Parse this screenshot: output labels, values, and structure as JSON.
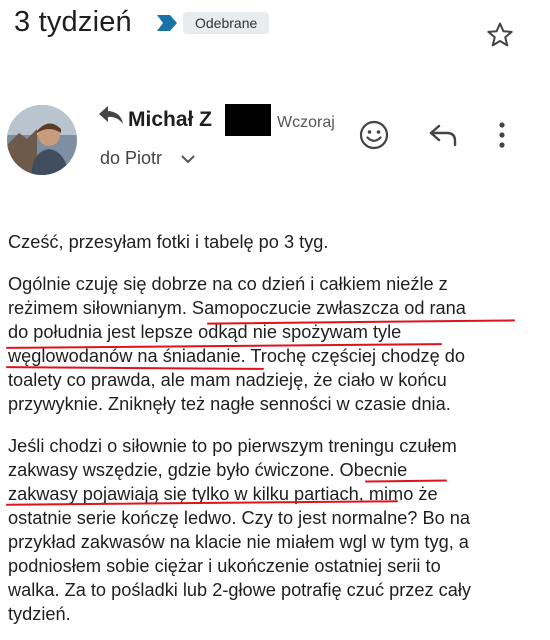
{
  "header": {
    "subject": "3 tydzień",
    "label": "Odebrane",
    "label_color": "#1a73a8"
  },
  "message": {
    "sender_name": "Michał Z",
    "date": "Wczoraj",
    "recipient": "do Piotr",
    "icons": {
      "replied": "reply-arrow-icon",
      "emoji": "emoji-smile-icon",
      "reply": "reply-icon",
      "more": "more-vert-icon",
      "star": "star-outline-icon",
      "expand": "chevron-down-icon"
    }
  },
  "body": {
    "greeting": "Cześć, przesyłam fotki i tabelę po 3 tyg.",
    "p1": [
      "Ogólnie czuję się dobrze na co dzień i całkiem nieźle z",
      "reżimem siłownianym. Samopoczucie zwłaszcza od rana",
      "do południa jest lepsze odkąd nie spożywam tyle",
      "węglowodanów na śniadanie. Trochę częściej chodzę do",
      "toalety co prawda, ale mam nadzieję, że ciało w końcu",
      "przywyknie. Zniknęły też nagłe senności w czasie dnia."
    ],
    "p2": [
      "Jeśli chodzi o siłownie to po pierwszym treningu czułem",
      "zakwasy wszędzie, gdzie było ćwiczone. Obecnie",
      "zakwasy pojawiają się tylko w kilku partiach, mimo że",
      "ostatnie serie kończę ledwo. Czy to jest normalne? Bo na",
      "przykład zakwasów na klacie nie miałem wgl w tym tyg, a",
      "podniosłem sobie ciężar i ukończenie ostatniej serii to",
      "walka. Za to pośladki lub 2-głowe potrafię czuć przez cały",
      "tydzień."
    ],
    "highlight_color": "#e0121b"
  }
}
